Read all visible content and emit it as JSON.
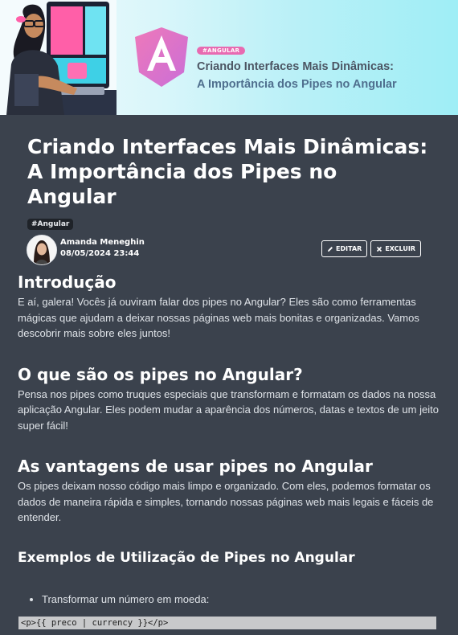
{
  "banner": {
    "tag": "#ANGULAR",
    "title_line1": "Criando Interfaces Mais Dinâmicas:",
    "title_line2": "A Importância dos Pipes no Angular"
  },
  "post": {
    "title": "Criando Interfaces Mais Dinâmicas: A Importância dos Pipes no Angular",
    "tag": "#Angular",
    "author": "Amanda Meneghin",
    "date": "08/05/2024 23:44"
  },
  "actions": {
    "edit_label": "EDITAR",
    "delete_label": "EXCLUIR",
    "edit_icon": "pencil-icon",
    "delete_icon": "x-icon"
  },
  "sections": [
    {
      "heading": "Introdução",
      "text": "E aí, galera! Vocês já ouviram falar dos pipes no Angular? Eles são como ferramentas mágicas que ajudam a deixar nossas páginas web mais bonitas e organizadas. Vamos descobrir mais sobre eles juntos!"
    },
    {
      "heading": "O que são os pipes no Angular?",
      "text": "Pensa nos pipes como truques especiais que transformam e formatam os dados na nossa aplicação Angular. Eles podem mudar a aparência dos números, datas e textos de um jeito super fácil!"
    },
    {
      "heading": "As vantagens de usar pipes no Angular",
      "text": "Os pipes deixam nosso código mais limpo e organizado. Com eles, podemos formatar os dados de maneira rápida e simples, tornando nossas páginas web mais legais e fáceis de entender."
    },
    {
      "heading": "Exemplos de Utilização de Pipes no Angular"
    }
  ],
  "examples": {
    "item1": "Transformar um número em moeda:",
    "code1": "<p>{{ preco | currency }}</p>"
  },
  "colors": {
    "background": "#3b424d",
    "tag_pink": "#e86ab1",
    "chip_bg": "#1f2329"
  }
}
